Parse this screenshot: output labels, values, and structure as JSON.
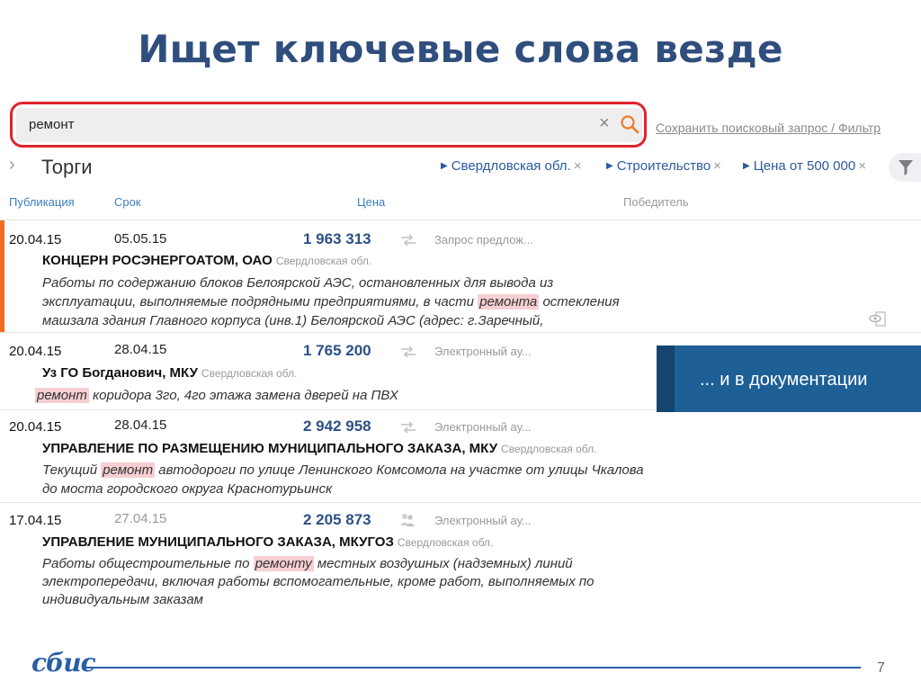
{
  "slide": {
    "title": "Ищет ключевые слова везде",
    "page_number": "7"
  },
  "search": {
    "value": "ремонт",
    "clear_icon": "close-icon",
    "search_icon": "magnifier-icon",
    "save_link": "Сохранить поисковый запрос / Фильтр"
  },
  "nav": {
    "section_title": "Торги",
    "filters": [
      {
        "label": "Свердловская обл."
      },
      {
        "label": "Строительство"
      },
      {
        "label": "Цена от 500 000"
      }
    ],
    "filter_icon": "funnel-icon"
  },
  "columns": {
    "publication": "Публикация",
    "deadline": "Срок",
    "price": "Цена",
    "winner": "Победитель"
  },
  "rows": [
    {
      "pub": "20.04.15",
      "due": "05.05.15",
      "price": "1 963 313",
      "type": "Запрос предлож...",
      "org": "КОНЦЕРН РОСЭНЕРГОАТОМ, ОАО",
      "region": "Свердловская обл.",
      "desc1_a": "Работы по содержанию блоков Белоярской АЭС, остановленных для вывода из",
      "desc2_a": "эксплуатации, выполняемые подрядными предприятиями, в части ",
      "desc2_hl": "ремонта",
      "desc2_b": " остекления",
      "desc3_a": "машзала здания Главного корпуса (инв.1) Белоярской АЭС (адрес: г.Заречный,"
    },
    {
      "pub": "20.04.15",
      "due": "28.04.15",
      "price": "1 765 200",
      "type": "Электронный ау...",
      "org": "Уз ГО Богданович, МКУ",
      "region": "Свердловская обл.",
      "desc1_hl": "ремонт",
      "desc1_b": " коридора 3го, 4го этажа замена дверей на ПВХ"
    },
    {
      "pub": "20.04.15",
      "due": "28.04.15",
      "price": "2 942 958",
      "type": "Электронный ау...",
      "org": "УПРАВЛЕНИЕ ПО РАЗМЕЩЕНИЮ МУНИЦИПАЛЬНОГО ЗАКАЗА, МКУ",
      "region": "Свердловская обл.",
      "desc1_a": "Текущий ",
      "desc1_hl": "ремонт",
      "desc1_b": " автодороги по улице Ленинского Комсомола на участке от улицы Чкалова",
      "desc2_a": "до моста городского округа Краснотурьинск"
    },
    {
      "pub": "17.04.15",
      "due": "27.04.15",
      "price": "2 205 873",
      "type": "Электронный ау...",
      "org": "УПРАВЛЕНИЕ МУНИЦИПАЛЬНОГО ЗАКАЗА, МКУГОЗ",
      "region": "Свердловская обл.",
      "desc1_a": "Работы общестроительные по ",
      "desc1_hl": "ремонту",
      "desc1_b": " местных воздушных (надземных) линий",
      "desc2_a": "электропередачи, включая работы вспомогательные, кроме работ, выполняемых по",
      "desc3_a": "индивидуальным заказам"
    }
  ],
  "banner": {
    "text": "... и в документации"
  },
  "footer": {
    "logo": "сбис"
  },
  "colors": {
    "title": "#2f4e7e",
    "accent_red": "#e0242b",
    "link_blue": "#2b5aa0",
    "price_blue": "#2d4f86",
    "highlight": "#f7cfd3",
    "active_bar": "#f26c22",
    "banner": "#1e5f96"
  }
}
